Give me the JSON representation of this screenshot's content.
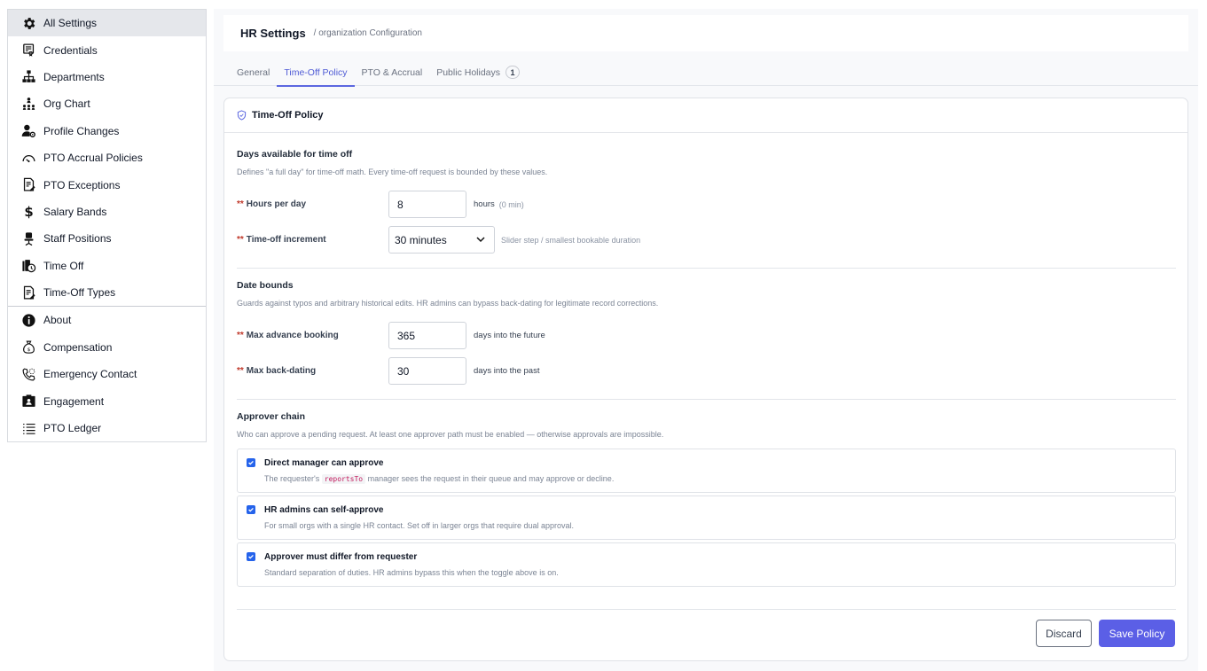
{
  "sidebar": {
    "group1": [
      {
        "label": "All Settings",
        "icon": "gear-icon",
        "active": true
      },
      {
        "label": "Credentials",
        "icon": "certificate-icon"
      },
      {
        "label": "Departments",
        "icon": "sitemap-icon"
      },
      {
        "label": "Org Chart",
        "icon": "org-chart-icon"
      },
      {
        "label": "Profile Changes",
        "icon": "user-gear-icon"
      },
      {
        "label": "PTO Accrual Policies",
        "icon": "gauge-icon"
      },
      {
        "label": "PTO Exceptions",
        "icon": "doc-edit-icon"
      },
      {
        "label": "Salary Bands",
        "icon": "dollar-icon"
      },
      {
        "label": "Staff Positions",
        "icon": "chair-icon"
      },
      {
        "label": "Time Off",
        "icon": "clock-luggage-icon"
      },
      {
        "label": "Time-Off Types",
        "icon": "doc-edit-icon"
      }
    ],
    "group2": [
      {
        "label": "About",
        "icon": "info-icon"
      },
      {
        "label": "Compensation",
        "icon": "money-bag-icon"
      },
      {
        "label": "Emergency Contact",
        "icon": "phone-icon"
      },
      {
        "label": "Engagement",
        "icon": "engagement-icon"
      },
      {
        "label": "PTO Ledger",
        "icon": "list-icon"
      }
    ]
  },
  "header": {
    "title": "HR Settings",
    "subtitle": "/ organization Configuration"
  },
  "tabs": [
    {
      "label": "General"
    },
    {
      "label": "Time-Off Policy",
      "active": true
    },
    {
      "label": "PTO & Accrual"
    },
    {
      "label": "Public Holidays",
      "badge": "1"
    }
  ],
  "card": {
    "title": "Time-Off Policy",
    "days": {
      "title": "Days available for time off",
      "desc": "Defines \"a full day\" for time-off math. Every time-off request is bounded by these values.",
      "hours_label": "Hours per day",
      "hours_value": "8",
      "hours_unit": "hours",
      "hours_hint": "(0 min)",
      "increment_label": "Time-off increment",
      "increment_value": "30 minutes",
      "increment_hint": "Slider step / smallest bookable duration"
    },
    "dates": {
      "title": "Date bounds",
      "desc": "Guards against typos and arbitrary historical edits. HR admins can bypass back-dating for legitimate record corrections.",
      "advance_label": "Max advance booking",
      "advance_value": "365",
      "advance_unit": "days into the future",
      "back_label": "Max back-dating",
      "back_value": "30",
      "back_unit": "days into the past"
    },
    "approvers": {
      "title": "Approver chain",
      "desc": "Who can approve a pending request. At least one approver path must be enabled — otherwise approvals are impossible.",
      "opt1_title": "Direct manager can approve",
      "opt1_desc_pre": "The requester's",
      "opt1_code": "reportsTo",
      "opt1_desc_post": "manager sees the request in their queue and may approve or decline.",
      "opt2_title": "HR admins can self-approve",
      "opt2_desc": "For small orgs with a single HR contact. Set off in larger orgs that require dual approval.",
      "opt3_title": "Approver must differ from requester",
      "opt3_desc": "Standard separation of duties. HR admins bypass this when the toggle above is on."
    },
    "required_marker": "**",
    "discard_label": "Discard",
    "save_label": "Save Policy"
  },
  "colors": {
    "accent": "#5b5fe6",
    "tab_active": "#4f5bd5",
    "checkbox": "#2563eb",
    "required": "#c0392b"
  }
}
